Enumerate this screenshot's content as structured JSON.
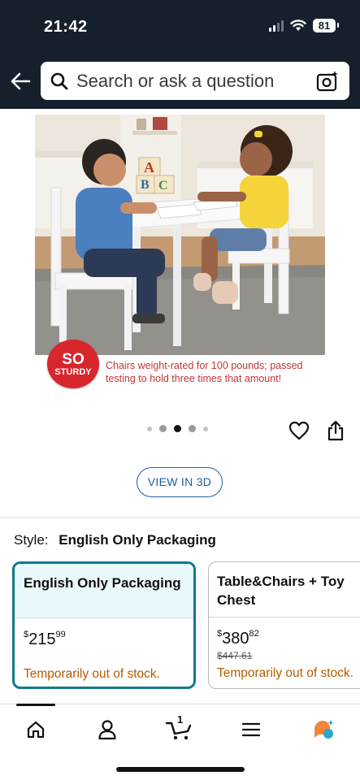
{
  "status_bar": {
    "time": "21:42",
    "battery": "81"
  },
  "search": {
    "placeholder": "Search or ask a question"
  },
  "product_image": {
    "badge_line1": "SO",
    "badge_line2": "STURDY",
    "caption": "Chairs weight-rated for 100 pounds; passed testing to hold three times that amount!",
    "blocks": [
      "A",
      "B",
      "C"
    ]
  },
  "carousel": {
    "count": 5,
    "active_index": 2
  },
  "view_3d": {
    "label": "VIEW IN 3D"
  },
  "style": {
    "label": "Style:",
    "value": "English Only Packaging"
  },
  "options": [
    {
      "title": "English Only Packaging",
      "price_symbol": "$",
      "price_whole": "215",
      "price_fraction": "99",
      "list_price": "",
      "availability": "Temporarily out of stock.",
      "selected": true
    },
    {
      "title": "Table&Chairs + Toy Chest",
      "price_symbol": "$",
      "price_whole": "380",
      "price_fraction": "82",
      "list_price": "$447.61",
      "availability": "Temporarily out of stock.",
      "selected": false
    }
  ],
  "bottom_nav": {
    "cart_count": "1",
    "items": [
      "home-icon",
      "account-icon",
      "cart-icon",
      "menu-icon",
      "rufus-icon"
    ]
  },
  "colors": {
    "header_bg": "#16202c",
    "accent_teal": "#117a8b",
    "link_blue": "#1d5fa0",
    "stock_orange": "#b35c00",
    "badge_red": "#d8262d"
  }
}
